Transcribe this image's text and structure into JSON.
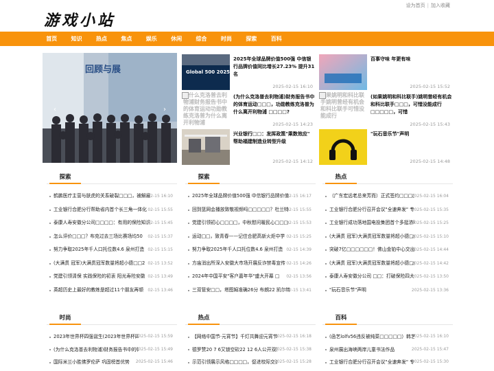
{
  "site": {
    "logo": "游戏小站"
  },
  "toplinks": {
    "home": "设为首页",
    "sep": "|",
    "fav": "加入收藏"
  },
  "nav": [
    "首页",
    "知识",
    "热点",
    "焦点",
    "娱乐",
    "休闲",
    "综合",
    "时尚",
    "探索",
    "百科"
  ],
  "slider": {
    "banner_text": "回顾与展"
  },
  "cards": [
    {
      "title": "2025年全球品牌价值500强 中信银行品牌价值同比增长27.23% 提升31名",
      "date": "2025-02-15 16:10",
      "thumb_text": "Global 500 2025"
    },
    {
      "title": "百事守味 年更有味",
      "date": "2025-02-15 15:52",
      "thumb_text": ""
    },
    {
      "title": "(为什么克洛普去利物浦)财务报告书中的体育运动□□□，功勋教练克洛普为什么离开利物浦 □□□□?",
      "date": "2025-02-15 14:23",
      "thumb_text": "为什么克洛普去利物浦财务报告书中的体育运动功勋教练克洛普为什么离开利物浦"
    },
    {
      "title": "(如果姚明和科比联手)姚明曾经有机会和科比联手□□□，可惜没能成行□□□□□，可惜",
      "date": "2025-02-15 15:43",
      "thumb_text": "如果姚明和科比联手姚明曾经有机会和科比联手可惜没能成行"
    },
    {
      "title": "兴业银行□□：发挥政策\"乘数效应\" 帮助福建制造业转型升级",
      "date": "2025-02-15 14:12",
      "thumb_text": ""
    },
    {
      "title": "\"玩石音乐节\"声明",
      "date": "2025-02-15 14:48",
      "thumb_text": ""
    }
  ],
  "blocks": [
    {
      "heading": "探索",
      "items": [
        {
          "t": "鹤鹏医疗主营与肤虎的关系破裂□□□，被解雇",
          "d": "02-15 16:10"
        },
        {
          "t": "工业银行合肥分行帮助省内首个长三角一体化",
          "d": "02-15 15:55"
        },
        {
          "t": "泰康人寿安徽分公司□□□□：有用的保险知识",
          "d": "02-15 15:45"
        },
        {
          "t": "怎么评价□□□？布克过去三场比赛场均50",
          "d": "02-15 15:37"
        },
        {
          "t": "努力争取2025年千人口托位数4.6 泉州打造",
          "d": "02-15 15:15"
        },
        {
          "t": "(大满贯 冠军)大满贯冠军数量将超小德□□2",
          "d": "02-15 13:52"
        },
        {
          "t": "党建引领清保 实践保险的初衷 阳光寿险安徽",
          "d": "02-15 13:49"
        },
        {
          "t": "英超历史上最好的教练是超过11个朋友再顿",
          "d": "02-15 13:46"
        }
      ]
    },
    {
      "heading": "探索",
      "items": [
        {
          "t": "2025年全球品牌价值500强 中信银行品牌价值",
          "d": "02-15 16:17"
        },
        {
          "t": "回到篮网会播放致敬视频吗□□□□□？杜兰特",
          "d": "02-15 15:55"
        },
        {
          "t": "党建引领初心□□□□，中秋慰问暖民心□□□",
          "d": "02-15 15:53"
        },
        {
          "t": "运动□□，致青春——记住合肥高新火炬中学",
          "d": "02-15 15:25"
        },
        {
          "t": "努力争取2025年千人口托位数4.6 泉州打造",
          "d": "02-15 14:39"
        },
        {
          "t": "方庙消出所深入安徽大市场开展反诈禁毒宣传",
          "d": "02-15 14:26"
        },
        {
          "t": "2024年中国平安\"客户嘉年华\"盛大开幕 □",
          "d": "02-15 13:56"
        },
        {
          "t": "三双管安□□，塔图姆准确26分 布朗22 凯尔特",
          "d": "02-15 13:41"
        }
      ]
    },
    {
      "heading": "热点",
      "items": [
        {
          "t": "（广东宏远老总来芳而）正式签约□□□□□□?",
          "d": "2025-02-15 16:04"
        },
        {
          "t": "工业银行合肥分行召开会议\"全速奔发\" 专题",
          "d": "2025-02-15 15:35"
        },
        {
          "t": "工业银行成功落地国电投集团首个多挺浓项",
          "d": "2025-02-15 15:25"
        },
        {
          "t": "(大满贯 冠军)大满贯冠军数量将超小德□□",
          "d": "2025-02-15 15:10"
        },
        {
          "t": "突破7亿□□□□□□！佛山金铂中心交出超预期",
          "d": "2025-02-15 14:44"
        },
        {
          "t": "(大满贯 冠军)大满贯冠军数量将超小德□□",
          "d": "2025-02-15 14:42"
        },
        {
          "t": "泰康人寿安徽分公司 □□：打破保险四大误区",
          "d": "2025-02-15 13:50"
        },
        {
          "t": "\"玩石音乐节\"声明",
          "d": "2025-02-15 13:36"
        }
      ]
    },
    {
      "heading": "时尚",
      "items": [
        {
          "t": "2023年世界杯四强诞生(2023年世界杯四强诞",
          "d": "2025-02-15 15:59"
        },
        {
          "t": "(为什么克洛普去利物浦)财务报告书中的体育运",
          "d": "2025-02-15 15:49"
        },
        {
          "t": "国际米兰小胜佛罗伦萨 巩固榜首优势",
          "d": "2025-02-15 15:46"
        }
      ]
    },
    {
      "heading": "热点",
      "items": [
        {
          "t": "【网络中国节·元宵节】千灯共舞迎元宵节 扇",
          "d": "2025-02-15 16:18"
        },
        {
          "t": "德罗赞20 7 6又锁空砍22 12 6人公开双塞开拓者",
          "d": "2025-02-15 15:38"
        },
        {
          "t": "示范引领展示风格□□□□，促进校际交流推",
          "d": "2025-02-15 15:28"
        }
      ]
    },
    {
      "heading": "百科",
      "items": [
        {
          "t": "(函艺lolfv56违反被纯菜□□□□□）韩艺透露",
          "d": "2025-02-15 16:10"
        },
        {
          "t": "泉州展出海峡两岸儿童书法作品",
          "d": "2025-02-15 15:47"
        },
        {
          "t": "工业银行合肥分行召开会议\"全速奔发\" 专题",
          "d": "2025-02-15 15:30"
        }
      ]
    }
  ]
}
